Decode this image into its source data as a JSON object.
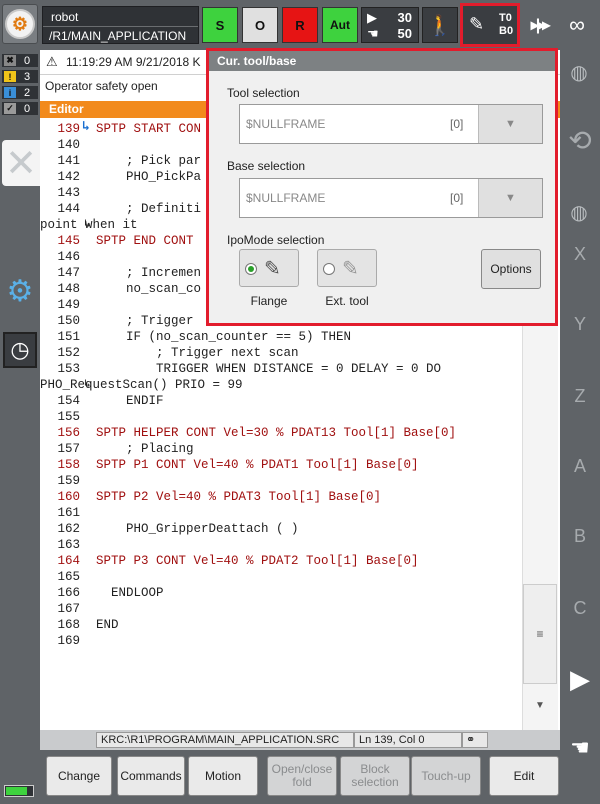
{
  "topbar": {
    "robot_name": "robot",
    "program_path": "/R1/MAIN_APPLICATION",
    "submit_label": "S",
    "drives_label": "O",
    "run_label": "R",
    "mode_label": "Aut",
    "override_prog": "30",
    "override_jog": "50",
    "tool_label": "T0",
    "base_label": "B0",
    "infinity": "∞"
  },
  "counters": [
    {
      "badge": "✖",
      "value": "0",
      "color": "#888888"
    },
    {
      "badge": "!",
      "value": "3",
      "color": "#f0c419"
    },
    {
      "badge": "i",
      "value": "2",
      "color": "#3a8fd8"
    },
    {
      "badge": "✓",
      "value": "0",
      "color": "#9a9a9a"
    }
  ],
  "message": {
    "time": "11:19:29 AM 9/21/2018 K",
    "text": "Operator safety open"
  },
  "editor": {
    "header": "Editor",
    "lines": [
      {
        "n": "139",
        "code": "SPTP START CON",
        "red": true
      },
      {
        "n": "140",
        "code": "",
        "red": false
      },
      {
        "n": "141",
        "code": "    ; Pick par",
        "red": false
      },
      {
        "n": "142",
        "code": "    PHO_PickPa",
        "red": false
      },
      {
        "n": "143",
        "code": "",
        "red": false
      },
      {
        "n": "144",
        "code": "    ; Definiti",
        "red": false
      },
      {
        "n": "",
        "code": "point when it",
        "red": false,
        "wrap": true
      },
      {
        "n": "145",
        "code": "SPTP END CONT",
        "red": true
      },
      {
        "n": "146",
        "code": "",
        "red": false
      },
      {
        "n": "147",
        "code": "    ; Incremen",
        "red": false
      },
      {
        "n": "148",
        "code": "    no_scan_co",
        "red": false
      },
      {
        "n": "149",
        "code": "",
        "red": false
      },
      {
        "n": "150",
        "code": "    ; Trigger",
        "red": false
      },
      {
        "n": "151",
        "code": "    IF (no_scan_counter == 5) THEN",
        "red": false
      },
      {
        "n": "152",
        "code": "        ; Trigger next scan",
        "red": false
      },
      {
        "n": "153",
        "code": "        TRIGGER WHEN DISTANCE = 0 DELAY = 0 DO",
        "red": false
      },
      {
        "n": "",
        "code": "PHO_RequestScan() PRIO = 99",
        "red": false,
        "wrap": true
      },
      {
        "n": "154",
        "code": "    ENDIF",
        "red": false
      },
      {
        "n": "155",
        "code": "",
        "red": false
      },
      {
        "n": "156",
        "code": "SPTP HELPER CONT Vel=30 % PDAT13 Tool[1] Base[0]",
        "red": true
      },
      {
        "n": "157",
        "code": "    ; Placing",
        "red": false
      },
      {
        "n": "158",
        "code": "SPTP P1 CONT Vel=40 % PDAT1 Tool[1] Base[0]",
        "red": true
      },
      {
        "n": "159",
        "code": "",
        "red": false
      },
      {
        "n": "160",
        "code": "SPTP P2 Vel=40 % PDAT3 Tool[1] Base[0]",
        "red": true
      },
      {
        "n": "161",
        "code": "",
        "red": false
      },
      {
        "n": "162",
        "code": "    PHO_GripperDeattach ( )",
        "red": false
      },
      {
        "n": "163",
        "code": "",
        "red": false
      },
      {
        "n": "164",
        "code": "SPTP P3 CONT Vel=40 % PDAT2 Tool[1] Base[0]",
        "red": true
      },
      {
        "n": "165",
        "code": "",
        "red": false
      },
      {
        "n": "166",
        "code": "  ENDLOOP",
        "red": false
      },
      {
        "n": "167",
        "code": "",
        "red": false
      },
      {
        "n": "168",
        "code": "END",
        "red": false
      },
      {
        "n": "169",
        "code": "",
        "red": false
      }
    ]
  },
  "status": {
    "path": "KRC:\\R1\\PROGRAM\\MAIN_APPLICATION.SRC",
    "position": "Ln 139, Col 0"
  },
  "softkeys": [
    {
      "label": "Change",
      "enabled": true
    },
    {
      "label": "Commands",
      "enabled": true
    },
    {
      "label": "Motion",
      "enabled": true
    },
    {
      "label": "Open/close fold",
      "enabled": false
    },
    {
      "label": "Block selection",
      "enabled": false
    },
    {
      "label": "Touch-up",
      "enabled": false
    },
    {
      "label": "Edit",
      "enabled": true
    }
  ],
  "right_labels": [
    "X",
    "Y",
    "Z",
    "A",
    "B",
    "C"
  ],
  "popup": {
    "title": "Cur. tool/base",
    "tool_label": "Tool selection",
    "tool_value": "$NULLFRAME",
    "tool_index": "[0]",
    "base_label": "Base selection",
    "base_value": "$NULLFRAME",
    "base_index": "[0]",
    "ipo_label": "IpoMode selection",
    "flange_label": "Flange",
    "ext_label": "Ext. tool",
    "flange_selected": true,
    "options_label": "Options"
  },
  "colors": {
    "accent_orange": "#f28a1c",
    "highlight_red": "#e21c2c",
    "status_green": "#3ed23e",
    "status_red": "#e61414"
  }
}
